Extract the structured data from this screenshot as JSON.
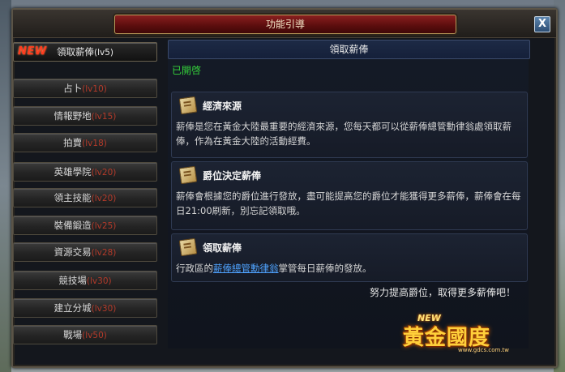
{
  "window": {
    "title": "功能引導",
    "close_label": "X"
  },
  "sidebar": {
    "new_badge": "NEW",
    "items": [
      {
        "label": "領取薪俸",
        "level": "(lv5)",
        "active": true
      },
      {
        "label": "占卜",
        "level": "(lv10)"
      },
      {
        "label": "情報野地",
        "level": "(lv15)"
      },
      {
        "label": "拍賣",
        "level": "(lv18)"
      },
      {
        "label": "英雄學院",
        "level": "(lv20)"
      },
      {
        "label": "領主技能",
        "level": "(lv20)"
      },
      {
        "label": "裝備鍛造",
        "level": "(lv25)"
      },
      {
        "label": "資源交易",
        "level": "(lv28)"
      },
      {
        "label": "競技場",
        "level": "(lv30)"
      },
      {
        "label": "建立分城",
        "level": "(lv30)"
      },
      {
        "label": "戰場",
        "level": "(lv50)"
      }
    ]
  },
  "content": {
    "header": "領取薪俸",
    "status": "已開啓",
    "cards": [
      {
        "title": "經濟來源",
        "body": "薪俸是您在黃金大陸最重要的經濟來源，您每天都可以從薪俸總管勳律翁處領取薪俸，作為在黃金大陸的活動經費。"
      },
      {
        "title": "爵位決定薪俸",
        "body": "薪俸會根據您的爵位進行發放，盡可能提高您的爵位才能獲得更多薪俸，薪俸會在每日21:00刷新，別忘記領取哦。"
      },
      {
        "title": "領取薪俸",
        "body_prefix": "行政區的",
        "link": "薪俸總管勳律翁",
        "body_suffix": "掌管每日薪俸的發放。"
      }
    ],
    "footer": "努力提高爵位，取得更多薪俸吧！"
  },
  "logo": {
    "new": "NEW",
    "name": "黃金國度",
    "url": "www.gdcs.com.tw"
  },
  "colors": {
    "status_green": "#35d33b",
    "level_red": "#b33a2a",
    "link_blue": "#4fa3ff",
    "title_red": "#8a1f1f"
  }
}
